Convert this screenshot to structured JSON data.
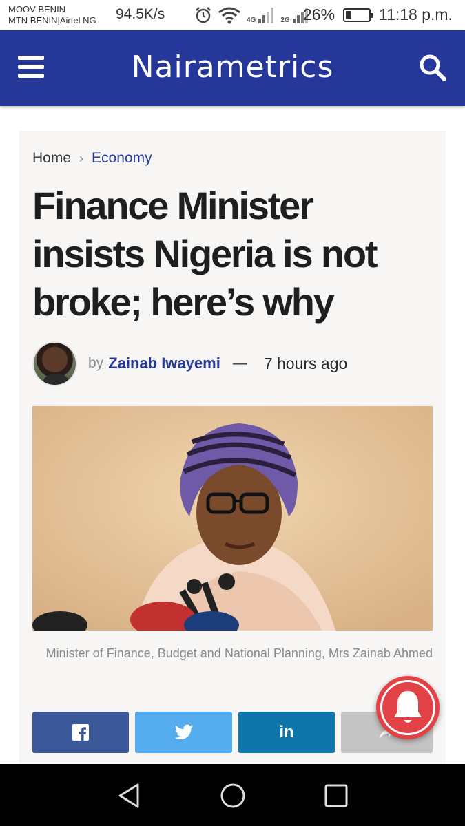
{
  "status_bar": {
    "carrier_1": "MOOV BENIN",
    "carrier_2": "MTN BENIN|Airtel NG",
    "speed": "94.5K/s",
    "net_4g": "4G",
    "net_2g": "2G",
    "battery_percent": "26%",
    "battery_level": 0.26,
    "time": "11:18 p.m."
  },
  "header": {
    "logo": "Nairametrics",
    "color": "#25389a",
    "menu_icon": "hamburger-icon",
    "search_icon": "search-icon"
  },
  "breadcrumb": {
    "home": "Home",
    "separator": "›",
    "section": "Economy"
  },
  "article": {
    "headline": "Finance Minister insists Nigeria is not broke; here’s why",
    "by": "by",
    "author": "Zainab Iwayemi",
    "dash": "—",
    "time_ago": "7 hours ago",
    "caption": "Minister of Finance, Budget and National Planning, Mrs Zainab Ahmed"
  },
  "share": [
    {
      "network": "facebook",
      "icon": "facebook-icon",
      "color": "#3b5898"
    },
    {
      "network": "twitter",
      "icon": "twitter-icon",
      "color": "#55acee"
    },
    {
      "network": "linkedin",
      "icon": "linkedin-icon",
      "label": "in",
      "color": "#0e76a8"
    },
    {
      "network": "more",
      "icon": "share-icon",
      "color": "#c4c4c4"
    }
  ],
  "notification": {
    "icon": "bell-icon",
    "color": "#e24245"
  },
  "navbar": {
    "back": "back-icon",
    "home": "home-icon",
    "recents": "recents-icon"
  }
}
